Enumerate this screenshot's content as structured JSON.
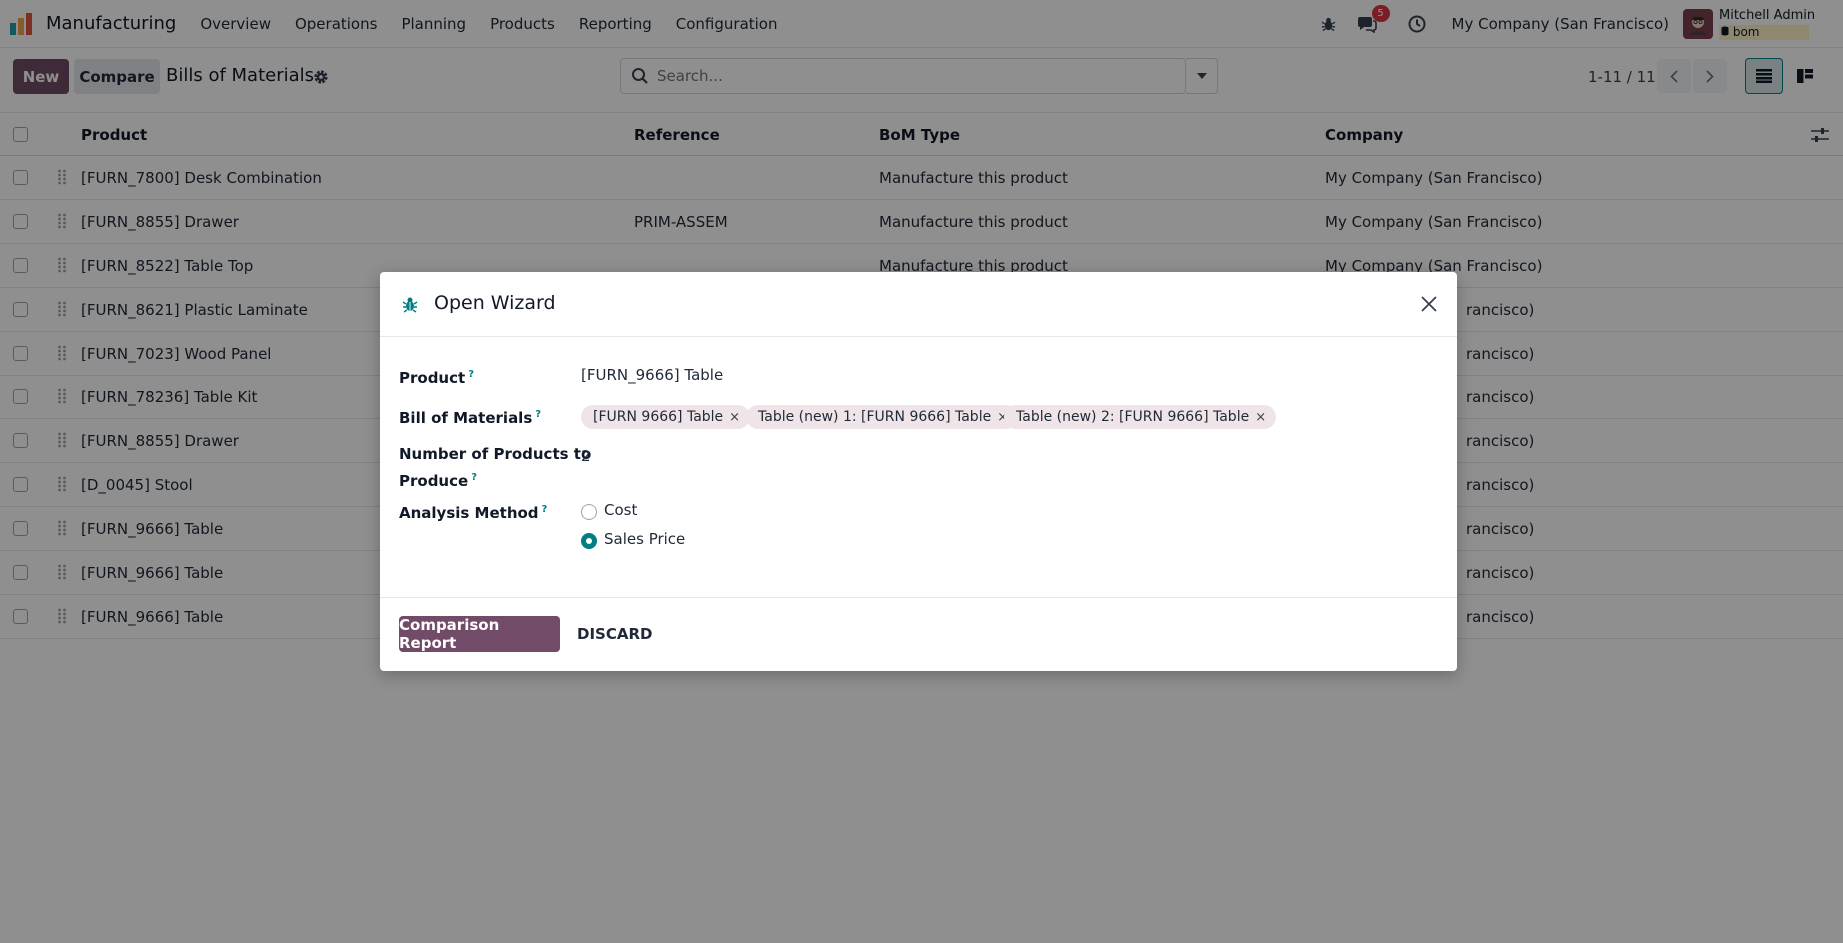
{
  "navbar": {
    "app_name": "Manufacturing",
    "menu": [
      "Overview",
      "Operations",
      "Planning",
      "Products",
      "Reporting",
      "Configuration"
    ],
    "messages_badge": "5",
    "company": "My Company (San Francisco)",
    "user_name": "Mitchell Admin",
    "user_db": "bom"
  },
  "control_panel": {
    "new_label": "New",
    "compare_label": "Compare",
    "title": "Bills of Materials",
    "search_placeholder": "Search...",
    "pager": "1-11 / 11"
  },
  "list": {
    "columns": [
      "Product",
      "Reference",
      "BoM Type",
      "Company"
    ],
    "rows": [
      {
        "product": "[FURN_7800] Desk Combination",
        "reference": "",
        "bom_type": "Manufacture this product",
        "company": "My Company (San Francisco)"
      },
      {
        "product": "[FURN_8855] Drawer",
        "reference": "PRIM-ASSEM",
        "bom_type": "Manufacture this product",
        "company": "My Company (San Francisco)"
      },
      {
        "product": "[FURN_8522] Table Top",
        "reference": "",
        "bom_type": "Manufacture this product",
        "company": "My Company (San Francisco)"
      },
      {
        "product": "[FURN_8621] Plastic Laminate",
        "reference": "",
        "bom_type": "",
        "company": "rancisco)"
      },
      {
        "product": "[FURN_7023] Wood Panel",
        "reference": "",
        "bom_type": "",
        "company": "rancisco)"
      },
      {
        "product": "[FURN_78236] Table Kit",
        "reference": "",
        "bom_type": "",
        "company": "rancisco)"
      },
      {
        "product": "[FURN_8855] Drawer",
        "reference": "",
        "bom_type": "",
        "company": "rancisco)"
      },
      {
        "product": "[D_0045] Stool",
        "reference": "",
        "bom_type": "",
        "company": "rancisco)"
      },
      {
        "product": "[FURN_9666] Table",
        "reference": "",
        "bom_type": "",
        "company": "rancisco)"
      },
      {
        "product": "[FURN_9666] Table",
        "reference": "",
        "bom_type": "",
        "company": "rancisco)"
      },
      {
        "product": "[FURN_9666] Table",
        "reference": "",
        "bom_type": "",
        "company": "rancisco)"
      }
    ]
  },
  "dialog": {
    "title": "Open Wizard",
    "product_label": "Product",
    "product_value": "[FURN_9666] Table",
    "bom_label": "Bill of Materials",
    "bom_tags": [
      "[FURN  9666] Table",
      "Table (new) 1: [FURN  9666] Table",
      "Table (new) 2: [FURN  9666] Table"
    ],
    "qty_label_line1": "Number of Products to",
    "qty_label_line2": "Produce",
    "qty_value": "2",
    "method_label": "Analysis Method",
    "method_options": [
      "Cost",
      "Sales Price"
    ],
    "method_selected": "Sales Price",
    "help_mark": "?",
    "tag_remove": "×",
    "confirm_label": "Comparison Report",
    "discard_label": "DISCARD"
  },
  "colors": {
    "brand": "#714b67",
    "accent": "#017e84",
    "badge": "#dc3545",
    "tag_bg": "#efe4e8"
  }
}
